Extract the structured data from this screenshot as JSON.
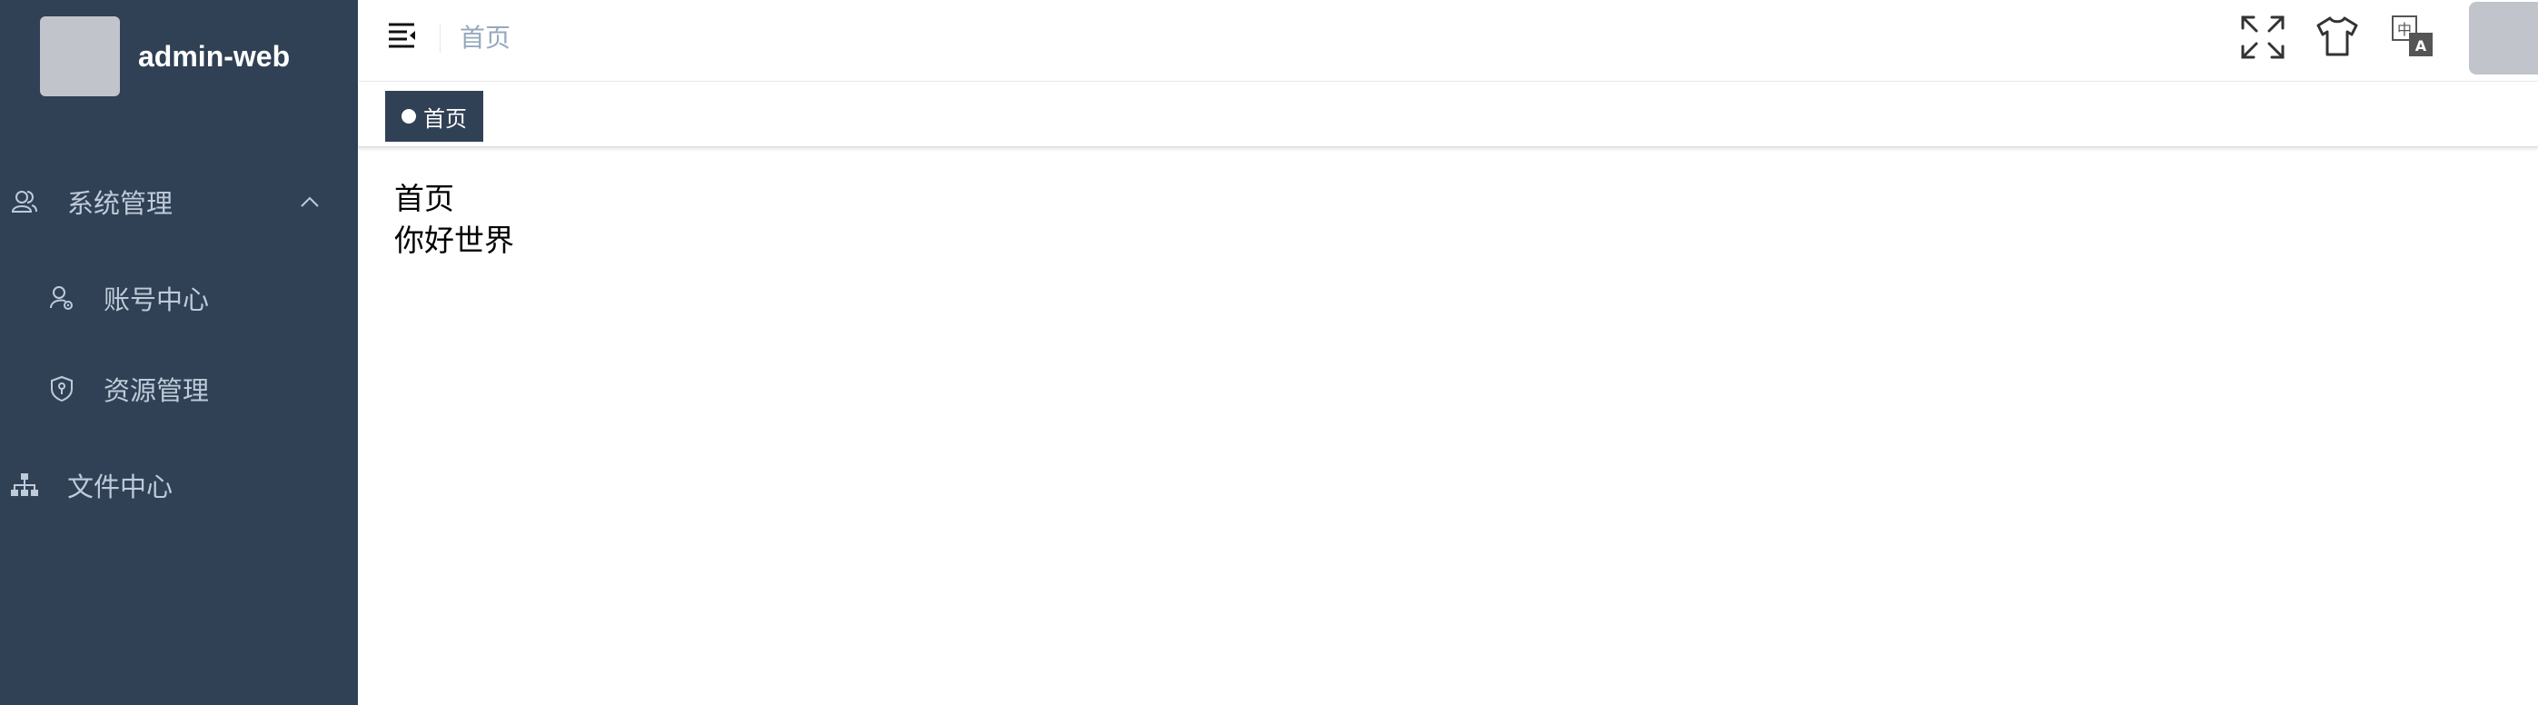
{
  "sidebar": {
    "app_name": "admin-web",
    "menu": [
      {
        "label": "系统管理",
        "icon": "user-group-icon",
        "expanded": true
      },
      {
        "label": "账号中心",
        "icon": "user-settings-icon"
      },
      {
        "label": "资源管理",
        "icon": "shield-icon"
      },
      {
        "label": "文件中心",
        "icon": "sitemap-icon"
      }
    ]
  },
  "header": {
    "breadcrumb": "首页",
    "icons": [
      "fullscreen-icon",
      "theme-shirt-icon",
      "language-icon",
      "avatar"
    ]
  },
  "tags": [
    {
      "label": "首页",
      "active": true
    }
  ],
  "content": {
    "title": "首页",
    "text": "你好世界"
  },
  "colors": {
    "sidebar_bg": "#304156",
    "sidebar_text": "#bfcbd9",
    "tag_active_bg": "#304156",
    "breadcrumb_text": "#97a8be"
  }
}
